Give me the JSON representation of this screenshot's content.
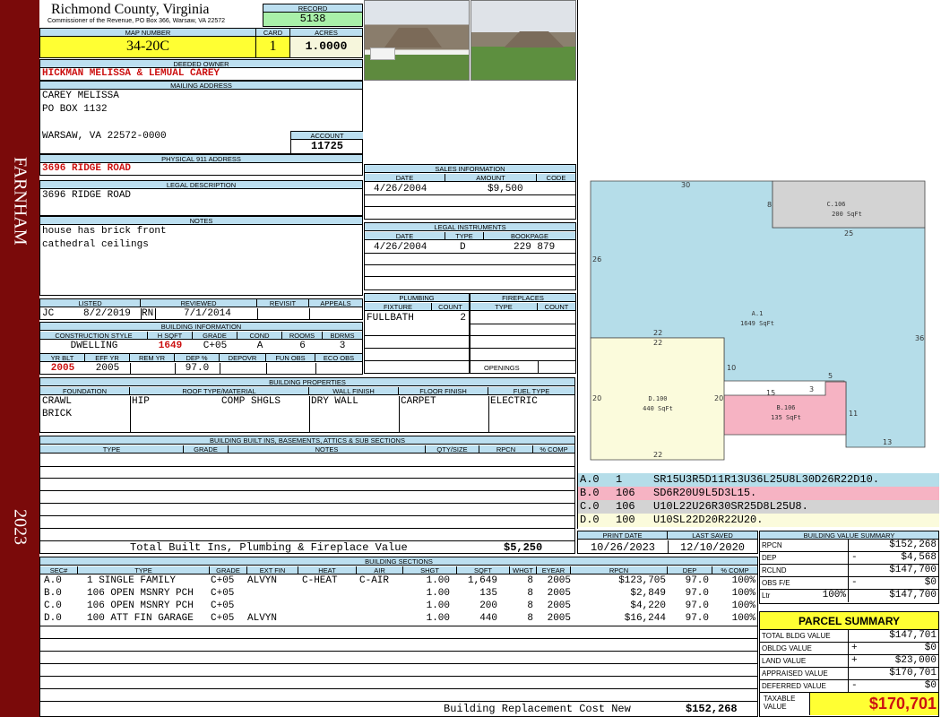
{
  "sidebar": {
    "district": "FARNHAM",
    "year": "2023"
  },
  "header": {
    "county": "Richmond County, Virginia",
    "commissioner": "Commissioner of the Revenue, PO Box 366, Warsaw, VA 22572",
    "record_label": "RECORD",
    "record": "5138",
    "map_label": "MAP NUMBER",
    "map_number": "34-20C",
    "card_label": "CARD",
    "card": "1",
    "acres_label": "ACRES",
    "acres": "1.0000"
  },
  "owner": {
    "deeded_label": "DEEDED OWNER",
    "deeded": "HICKMAN MELISSA & LEMUAL CAREY",
    "mailing_label": "MAILING ADDRESS",
    "mailing": [
      "CAREY MELISSA",
      "PO BOX 1132",
      "",
      "WARSAW, VA 22572-0000"
    ],
    "account_label": "ACCOUNT",
    "account": "11725",
    "physical_label": "PHYSICAL 911 ADDRESS",
    "physical": "3696 RIDGE ROAD",
    "legal_label": "LEGAL DESCRIPTION",
    "legal": "3696 RIDGE ROAD",
    "notes_label": "NOTES",
    "notes": [
      "house has brick front",
      "cathedral ceilings"
    ]
  },
  "review": {
    "listed_label": "LISTED",
    "reviewed_label": "REVIEWED",
    "revisit_label": "REVISIT",
    "appeals_label": "APPEALS",
    "listed_by": "JC",
    "listed_date": "8/2/2019",
    "reviewed_by": "RN",
    "reviewed_date": "7/1/2014"
  },
  "building_info": {
    "title": "BUILDING INFORMATION",
    "headers": [
      "CONSTRUCTION STYLE",
      "H SQFT",
      "GRADE",
      "COND",
      "ROOMS",
      "BDRMS"
    ],
    "values": [
      "DWELLING",
      "1649",
      "C+05",
      "A",
      "6",
      "3"
    ],
    "headers2": [
      "YR BLT",
      "EFF YR",
      "REM YR",
      "DEP %",
      "DEPOVR",
      "FUN OBS",
      "ECO OBS"
    ],
    "values2": [
      "2005",
      "2005",
      "",
      "97.0",
      "",
      "",
      ""
    ]
  },
  "sales": {
    "title": "SALES INFORMATION",
    "headers": [
      "DATE",
      "AMOUNT",
      "CODE"
    ],
    "rows": [
      [
        "4/26/2004",
        "$9,500",
        ""
      ]
    ]
  },
  "legal_instruments": {
    "title": "LEGAL INSTRUMENTS",
    "headers": [
      "DATE",
      "TYPE",
      "BOOKPAGE"
    ],
    "rows": [
      [
        "4/26/2004",
        "D",
        "229 879"
      ]
    ]
  },
  "plumbing": {
    "title": "PLUMBING",
    "headers": [
      "FIXTURE",
      "COUNT"
    ],
    "rows": [
      [
        "FULLBATH",
        "2"
      ]
    ]
  },
  "fireplaces": {
    "title": "FIREPLACES",
    "headers": [
      "TYPE",
      "COUNT"
    ],
    "openings_label": "OPENINGS"
  },
  "building_properties": {
    "title": "BUILDING PROPERTIES",
    "headers": [
      "FOUNDATION",
      "ROOF TYPE/MATERIAL",
      "WALL FINISH",
      "FLOOR FINISH",
      "FUEL TYPE"
    ],
    "foundation": [
      "CRAWL",
      "BRICK"
    ],
    "roof_type": "HIP",
    "roof_material": "COMP SHGLS",
    "wall": "DRY WALL",
    "floor": "CARPET",
    "fuel": "ELECTRIC"
  },
  "builtins": {
    "title": "BUILDING BUILT INS, BASEMENTS, ATTICS & SUB SECTIONS",
    "headers": [
      "TYPE",
      "GRADE",
      "NOTES",
      "QTY/SIZE",
      "RPCN",
      "% COMP"
    ],
    "total_label": "Total Built Ins, Plumbing & Fireplace Value",
    "total": "$5,250"
  },
  "sketch": {
    "sections": [
      {
        "code": "A.1",
        "sqft": "1649 SqFt"
      },
      {
        "code": "B.106",
        "sqft": "135 SqFt"
      },
      {
        "code": "C.106",
        "sqft": "200 SqFt"
      },
      {
        "code": "D.100",
        "sqft": "440 SqFt"
      }
    ],
    "dims": [
      "30",
      "8",
      "25",
      "26",
      "36",
      "22",
      "22",
      "10",
      "20",
      "20",
      "15",
      "3",
      "5",
      "11",
      "22",
      "13"
    ],
    "colors": {
      "A": "#b5dde9",
      "B": "#f6b3c3",
      "C": "#d3d3d3",
      "D": "#fbfbdc"
    }
  },
  "traverse": [
    {
      "sec": "A.0",
      "code": "1",
      "path": "SR15U3R5D11R13U36L25U8L30D26R22D10."
    },
    {
      "sec": "B.0",
      "code": "106",
      "path": "SD6R20U9L5D3L15."
    },
    {
      "sec": "C.0",
      "code": "106",
      "path": "U10L22U26R30SR25D8L25U8."
    },
    {
      "sec": "D.0",
      "code": "100",
      "path": "U10SL22D20R22U20."
    }
  ],
  "print": {
    "print_label": "PRINT DATE",
    "print_date": "10/26/2023",
    "saved_label": "LAST SAVED",
    "saved_date": "12/10/2020"
  },
  "sections": {
    "title": "BUILDING SECTIONS",
    "headers": [
      "SEC#",
      "TYPE",
      "GRADE",
      "EXT FIN",
      "HEAT",
      "AIR",
      "SHGT",
      "SQFT",
      "WHGT",
      "EYEAR",
      "RPCN",
      "DEP",
      "% COMP"
    ],
    "rows": [
      [
        "A.0",
        "1 SINGLE FAMILY",
        "C+05",
        "ALVYN",
        "C-HEAT",
        "C-AIR",
        "1.00",
        "1,649",
        "8",
        "2005",
        "$123,705",
        "97.0",
        "100%"
      ],
      [
        "B.0",
        "106 OPEN MSNRY PCH",
        "C+05",
        "",
        "",
        "",
        "1.00",
        "135",
        "8",
        "2005",
        "$2,849",
        "97.0",
        "100%"
      ],
      [
        "C.0",
        "106 OPEN MSNRY PCH",
        "C+05",
        "",
        "",
        "",
        "1.00",
        "200",
        "8",
        "2005",
        "$4,220",
        "97.0",
        "100%"
      ],
      [
        "D.0",
        "100 ATT FIN GARAGE",
        "C+05",
        "ALVYN",
        "",
        "",
        "1.00",
        "440",
        "8",
        "2005",
        "$16,244",
        "97.0",
        "100%"
      ]
    ],
    "replacement_label": "Building Replacement Cost New",
    "replacement": "$152,268"
  },
  "value_summary": {
    "title": "BUILDING VALUE SUMMARY",
    "rows": [
      {
        "label": "RPCN",
        "sign": "",
        "value": "$152,268"
      },
      {
        "label": "DEP",
        "sign": "-",
        "value": "$4,568"
      },
      {
        "label": "RCLND",
        "sign": "",
        "value": "$147,700"
      },
      {
        "label": "OBS F/E",
        "sign": "-",
        "value": "$0"
      },
      {
        "label": "Ltr",
        "pct": "100%",
        "sign": "",
        "value": "$147,700"
      }
    ]
  },
  "parcel": {
    "title": "PARCEL SUMMARY",
    "rows": [
      {
        "label": "TOTAL BLDG VALUE",
        "sign": "",
        "value": "$147,701"
      },
      {
        "label": "OBLDG VALUE",
        "sign": "+",
        "value": "$0"
      },
      {
        "label": "LAND VALUE",
        "sign": "+",
        "value": "$23,000"
      },
      {
        "label": "APPRAISED VALUE",
        "sign": "",
        "value": "$170,701"
      },
      {
        "label": "DEFERRED VALUE",
        "sign": "-",
        "value": "$0"
      }
    ],
    "taxable_label": "TAXABLE VALUE",
    "taxable": "$170,701"
  }
}
